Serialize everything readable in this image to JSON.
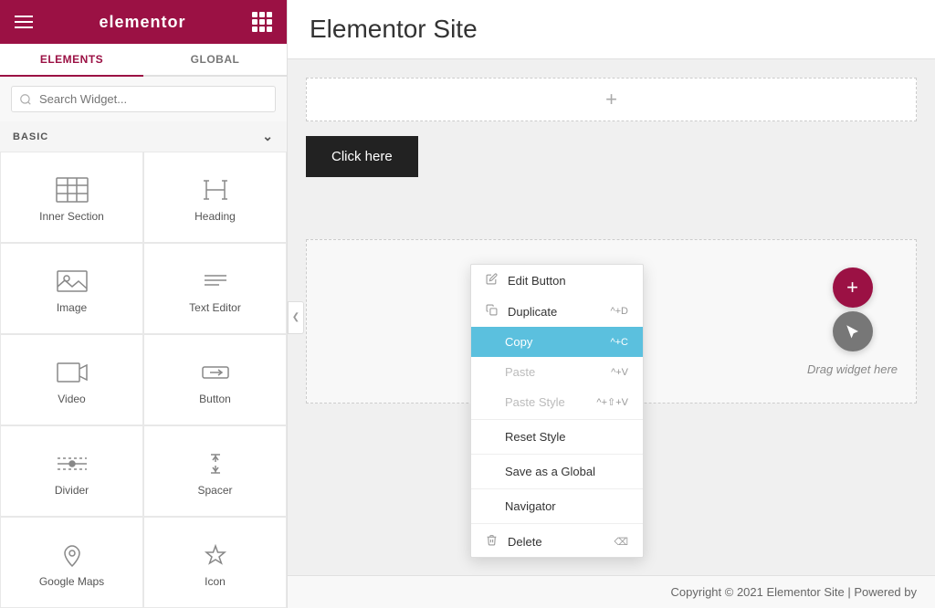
{
  "header": {
    "logo": "elementor",
    "tabs": [
      "ELEMENTS",
      "GLOBAL"
    ]
  },
  "search": {
    "placeholder": "Search Widget..."
  },
  "section_label": "BASIC",
  "widgets": [
    {
      "id": "inner-section",
      "label": "Inner Section",
      "icon": "inner-section-icon"
    },
    {
      "id": "heading",
      "label": "Heading",
      "icon": "heading-icon"
    },
    {
      "id": "image",
      "label": "Image",
      "icon": "image-icon"
    },
    {
      "id": "text-editor",
      "label": "Text Editor",
      "icon": "text-editor-icon"
    },
    {
      "id": "video",
      "label": "Video",
      "icon": "video-icon"
    },
    {
      "id": "button",
      "label": "Button",
      "icon": "button-icon"
    },
    {
      "id": "divider",
      "label": "Divider",
      "icon": "divider-icon"
    },
    {
      "id": "spacer",
      "label": "Spacer",
      "icon": "spacer-icon"
    },
    {
      "id": "google-maps",
      "label": "Google Maps",
      "icon": "google-maps-icon"
    },
    {
      "id": "icon",
      "label": "Icon",
      "icon": "icon-icon"
    }
  ],
  "canvas": {
    "title": "Elementor Site",
    "add_section_icon": "+",
    "click_button_label": "Click here",
    "drag_label": "Drag widget here",
    "footer_text": "Copyright © 2021 Elementor Site | Powered by"
  },
  "context_menu": {
    "items": [
      {
        "label": "Edit Button",
        "shortcut": "",
        "icon": "edit-icon",
        "state": "normal"
      },
      {
        "label": "Duplicate",
        "shortcut": "^+D",
        "icon": "duplicate-icon",
        "state": "normal"
      },
      {
        "label": "Copy",
        "shortcut": "^+C",
        "icon": "",
        "state": "active"
      },
      {
        "label": "Paste",
        "shortcut": "^+V",
        "icon": "",
        "state": "disabled"
      },
      {
        "label": "Paste Style",
        "shortcut": "^+⇧+V",
        "icon": "",
        "state": "disabled"
      },
      {
        "label": "Reset Style",
        "shortcut": "",
        "icon": "",
        "state": "normal"
      },
      {
        "label": "Save as a Global",
        "shortcut": "",
        "icon": "",
        "state": "normal"
      },
      {
        "label": "Navigator",
        "shortcut": "",
        "icon": "",
        "state": "normal"
      },
      {
        "label": "Delete",
        "shortcut": "⌫",
        "icon": "delete-icon",
        "state": "normal"
      }
    ]
  }
}
